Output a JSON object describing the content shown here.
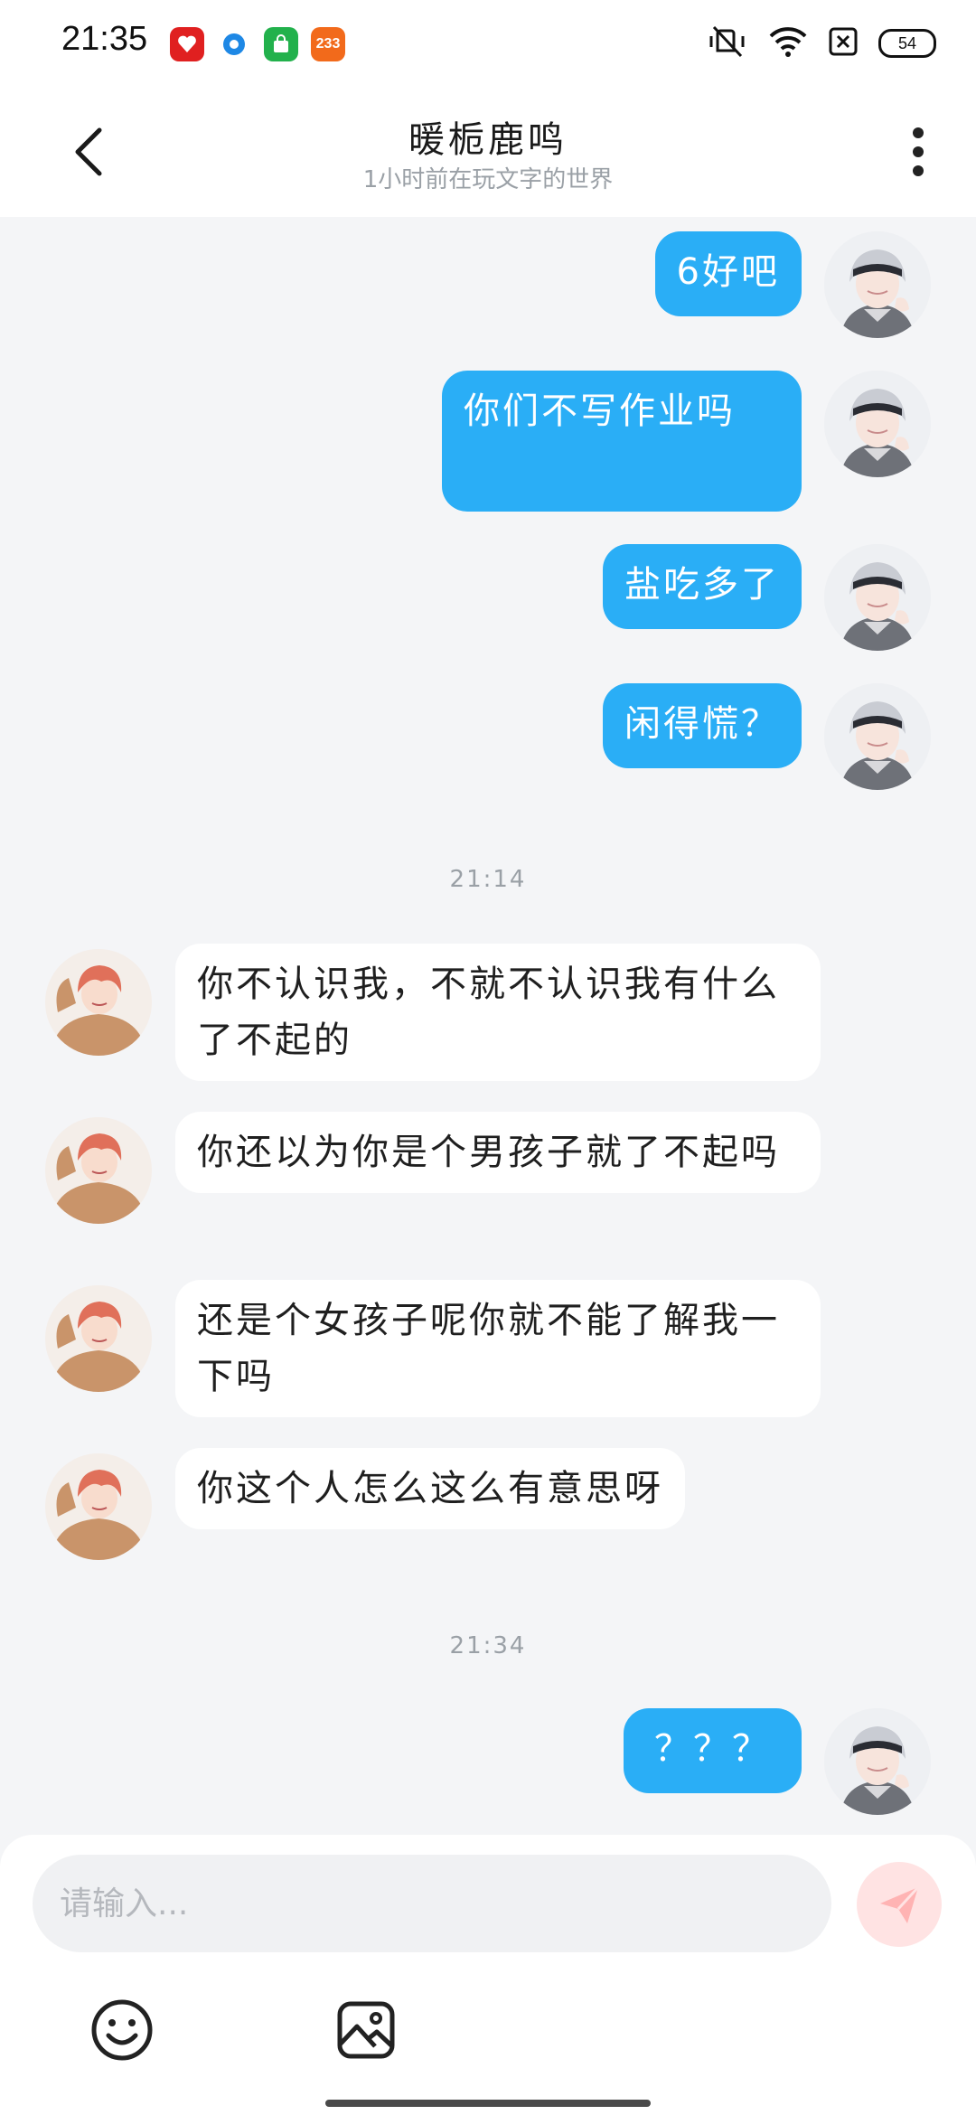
{
  "status_bar": {
    "time": "21:35",
    "battery": "54",
    "app_icons": [
      {
        "icon": "pinduoduo-app-icon",
        "color": "#e02020",
        "label": ""
      },
      {
        "icon": "browser-app-icon",
        "color": "#1e88e5",
        "label": ""
      },
      {
        "icon": "store-app-icon",
        "color": "#22b14c",
        "label": ""
      },
      {
        "icon": "game-233-app-icon",
        "color": "#f26a1b",
        "label": "233"
      }
    ],
    "indicators": [
      "mute-vibrate-icon",
      "wifi-icon",
      "sim-disabled-icon",
      "battery-icon"
    ]
  },
  "header": {
    "title": "暖栀鹿鸣",
    "subtitle": "1小时前在玩文字的世界"
  },
  "messages": [
    {
      "sender": "me",
      "text": "6好吧"
    },
    {
      "sender": "me",
      "text": "你们不写作业吗"
    },
    {
      "sender": "me",
      "text": "盐吃多了"
    },
    {
      "sender": "me",
      "text": "闲得慌？"
    },
    {
      "type": "time",
      "text": "21:14"
    },
    {
      "sender": "them",
      "text": "你不认识我，不就不认识我有什么了不起的"
    },
    {
      "sender": "them",
      "text": "你还以为你是个男孩子就了不起吗"
    },
    {
      "sender": "them",
      "text": "还是个女孩子呢你就不能了解我一下吗"
    },
    {
      "sender": "them",
      "text": "你这个人怎么这么有意思呀"
    },
    {
      "type": "time",
      "text": "21:34"
    },
    {
      "sender": "me",
      "text": "？？？"
    }
  ],
  "input": {
    "placeholder": "请输入..."
  },
  "toolbar": {
    "items": [
      "emoji-icon",
      "image-icon"
    ]
  },
  "colors": {
    "my_bubble": "#2aaef6",
    "their_bubble": "#ffffff",
    "background": "#f4f5f7",
    "send_button": "#ffe3e3"
  }
}
